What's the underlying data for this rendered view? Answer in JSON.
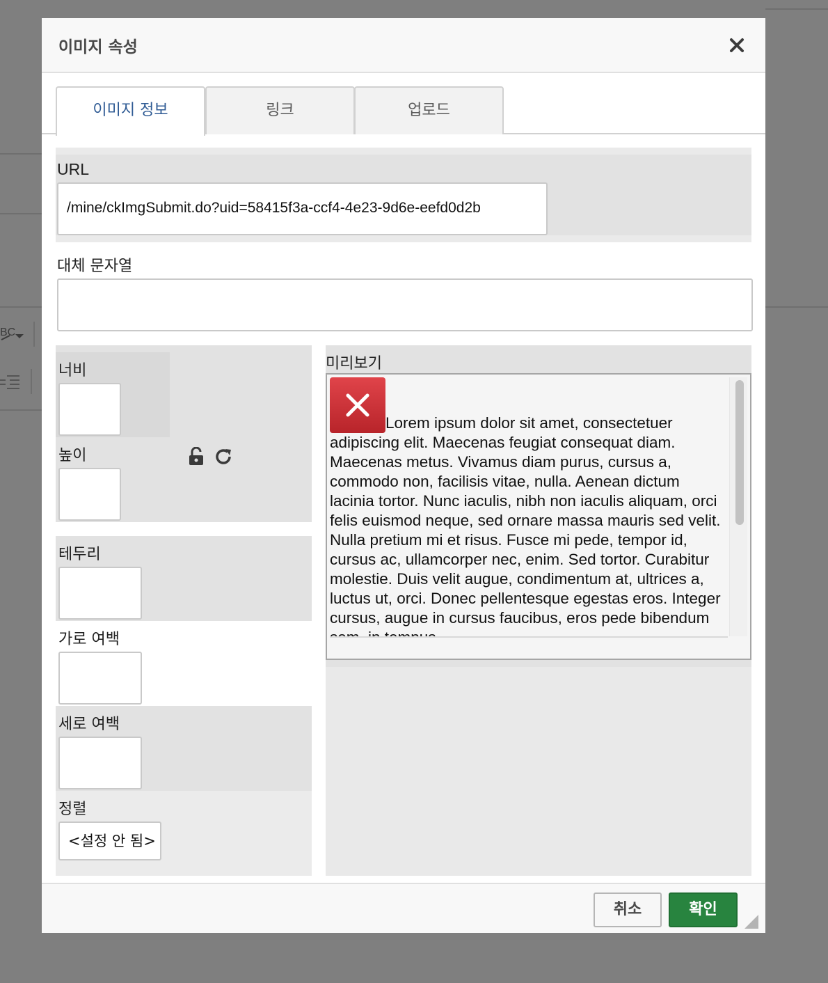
{
  "dialog": {
    "title": "이미지 속성",
    "close_icon": "close-icon"
  },
  "tabs": [
    {
      "label": "이미지 정보",
      "active": true
    },
    {
      "label": "링크",
      "active": false
    },
    {
      "label": "업로드",
      "active": false
    }
  ],
  "info": {
    "url_label": "URL",
    "url_value": "/mine/ckImgSubmit.do?uid=58415f3a-ccf4-4e23-9d6e-eefd0d2b",
    "alt_label": "대체 문자열",
    "alt_value": "",
    "width_label": "너비",
    "height_label": "높이",
    "border_label": "테두리",
    "hspace_label": "가로 여백",
    "vspace_label": "세로 여백",
    "align_label": "정렬",
    "align_value": "<설정 안 됨>",
    "lock_icon": "lock-open-icon",
    "reset_icon": "reset-size-icon"
  },
  "preview": {
    "label": "미리보기",
    "broken_image_icon": "broken-image-icon",
    "text": "Lorem ipsum dolor sit amet, consectetuer adipiscing elit. Maecenas feugiat consequat diam. Maecenas metus. Vivamus diam purus, cursus a, commodo non, facilisis vitae, nulla. Aenean dictum lacinia tortor. Nunc iaculis, nibh non iaculis aliquam, orci felis euismod neque, sed ornare massa mauris sed velit. Nulla pretium mi et risus. Fusce mi pede, tempor id, cursus ac, ullamcorper nec, enim. Sed tortor. Curabitur molestie. Duis velit augue, condimentum at, ultrices a, luctus ut, orci. Donec pellentesque egestas eros. Integer cursus, augue in cursus faucibus, eros pede bibendum sem, in tempus"
  },
  "footer": {
    "cancel_label": "취소",
    "ok_label": "확인"
  },
  "colors": {
    "ok_button": "#28843f",
    "active_tab_text": "#2f5b94",
    "broken_image": "#c8302f"
  }
}
